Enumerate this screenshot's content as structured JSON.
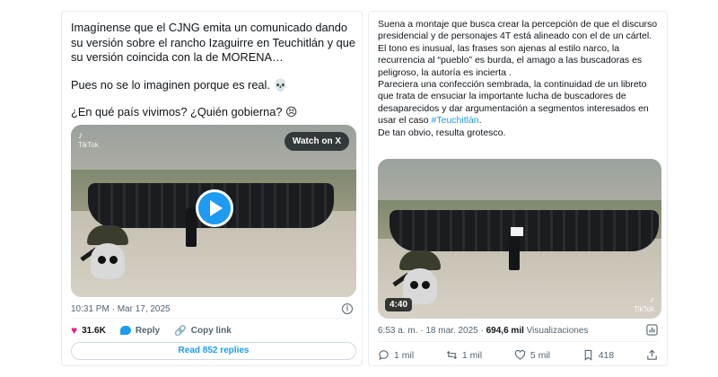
{
  "left_tweet": {
    "text_p1": "Imagínense que el CJNG emita un comunicado dando su versión sobre el rancho Izaguirre en Teuchitlán y que su versión coincida con la de MORENA…",
    "text_p2": "Pues no se lo imaginen porque es real. 💀",
    "text_p3": "¿En qué país vivimos? ¿Quién gobierna? 😣",
    "media": {
      "watch_label": "Watch on X",
      "tiktok_label": "TikTok"
    },
    "timestamp": "10:31 PM · Mar 17, 2025",
    "info_glyph": "i",
    "actions": {
      "like_count": "31.6K",
      "reply_label": "Reply",
      "copy_link_label": "Copy link"
    },
    "read_replies_label": "Read 852 replies"
  },
  "right_tweet": {
    "text_p1": "Suena a montaje que busca crear la percepción de que el discurso presidencial y de personajes 4T está alineado con el de un cártel. El tono es inusual, las frases son ajenas al estilo narco, la recurrencia al “pueblo” es burda, el amago a las buscadoras es peligroso, la autoría es incierta .",
    "text_p2_a": "Pareciera una confección sembrada, la continuidad de un libreto que trata de ensuciar la importante lucha de buscadores de desaparecidos y dar argumentación a segmentos interesados en usar el caso ",
    "hashtag": "#Teuchitlán",
    "text_p2_b": ".",
    "text_p3": "De tan obvio, resulta grotesco.",
    "media": {
      "duration": "4:40",
      "tiktok_label": "TikTok"
    },
    "timestamp": "6:53 a. m. · 18 mar. 2025 · ",
    "views_count": "694,6 mil",
    "views_label": " Visualizaciones",
    "bar": {
      "replies": "1 mil",
      "reposts": "1 mil",
      "likes": "5 mil",
      "bookmarks": "418"
    }
  },
  "icons": {
    "like": "heart-icon",
    "reply": "reply-icon",
    "link": "link-icon",
    "info": "info-icon",
    "analytics": "analytics-icon",
    "repost": "repost-icon",
    "bookmark": "bookmark-icon",
    "share": "share-icon",
    "play": "play-icon"
  },
  "colors": {
    "accent": "#1d9bf0",
    "like": "#f91880",
    "muted": "#536471",
    "text": "#0f1419"
  }
}
